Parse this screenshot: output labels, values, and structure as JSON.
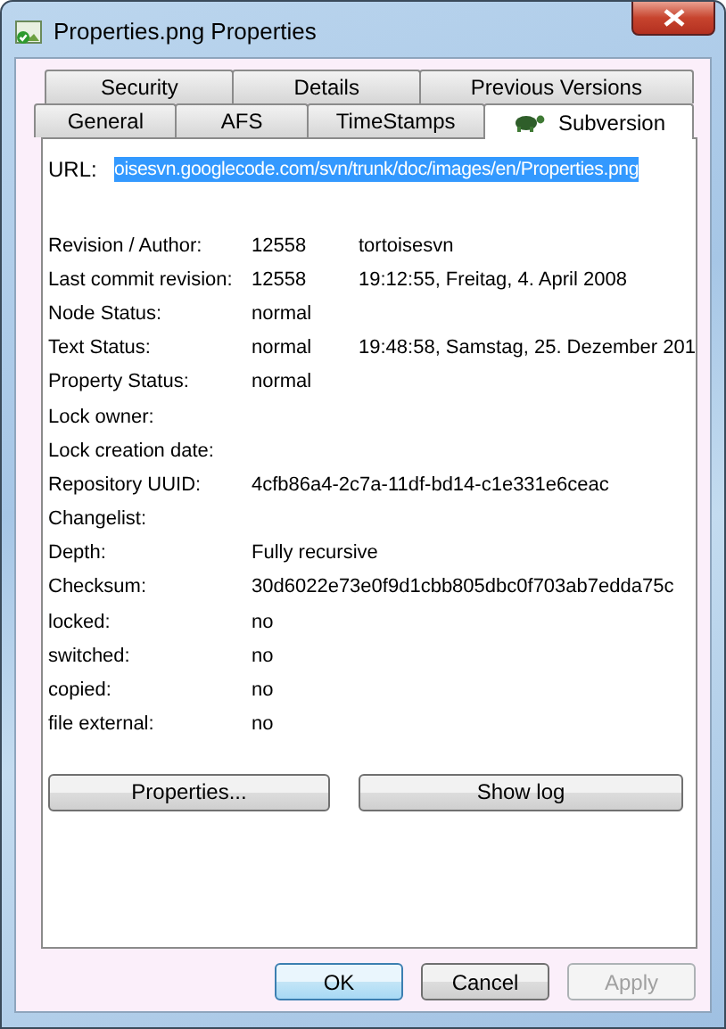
{
  "window": {
    "title": "Properties.png Properties"
  },
  "tab_rows": [
    [
      {
        "label": "Security",
        "selected": false
      },
      {
        "label": "Details",
        "selected": false
      },
      {
        "label": "Previous Versions",
        "selected": false
      }
    ],
    [
      {
        "label": "General",
        "selected": false
      },
      {
        "label": "AFS",
        "selected": false
      },
      {
        "label": "TimeStamps",
        "selected": false
      },
      {
        "label": "Subversion",
        "selected": true
      }
    ]
  ],
  "url": {
    "label": "URL:",
    "value": "oisesvn.googlecode.com/svn/trunk/doc/images/en/Properties.png",
    "selected": true
  },
  "properties": [
    {
      "label": "Revision / Author:",
      "value": "12558",
      "extra": "tortoisesvn"
    },
    {
      "label": "Last commit revision:",
      "value": "12558",
      "extra": "19:12:55, Freitag, 4. April 2008"
    },
    {
      "label": "Node Status:",
      "value": "normal"
    },
    {
      "label": "Text Status:",
      "value": "normal",
      "extra": "19:48:58, Samstag, 25. Dezember 201"
    },
    {
      "label": "Property Status:",
      "value": "normal"
    },
    {
      "label": "Lock owner:"
    },
    {
      "label": "Lock creation date:"
    },
    {
      "label": "Repository UUID:",
      "value": "4cfb86a4-2c7a-11df-bd14-c1e331e6ceac"
    },
    {
      "label": "Changelist:"
    },
    {
      "label": "Depth:",
      "value": "Fully recursive"
    },
    {
      "label": "Checksum:",
      "value": "30d6022e73e0f9d1cbb805dbc0f703ab7edda75c"
    },
    {
      "label": "locked:",
      "value": "no"
    },
    {
      "label": "switched:",
      "value": "no"
    },
    {
      "label": "copied:",
      "value": "no"
    },
    {
      "label": "file external:",
      "value": "no"
    }
  ],
  "panel_buttons": [
    {
      "label": "Properties..."
    },
    {
      "label": "Show log"
    }
  ],
  "dialog_buttons": [
    {
      "label": "OK",
      "default": true,
      "disabled": false
    },
    {
      "label": "Cancel",
      "default": false,
      "disabled": false
    },
    {
      "label": "Apply",
      "default": false,
      "disabled": true
    }
  ]
}
